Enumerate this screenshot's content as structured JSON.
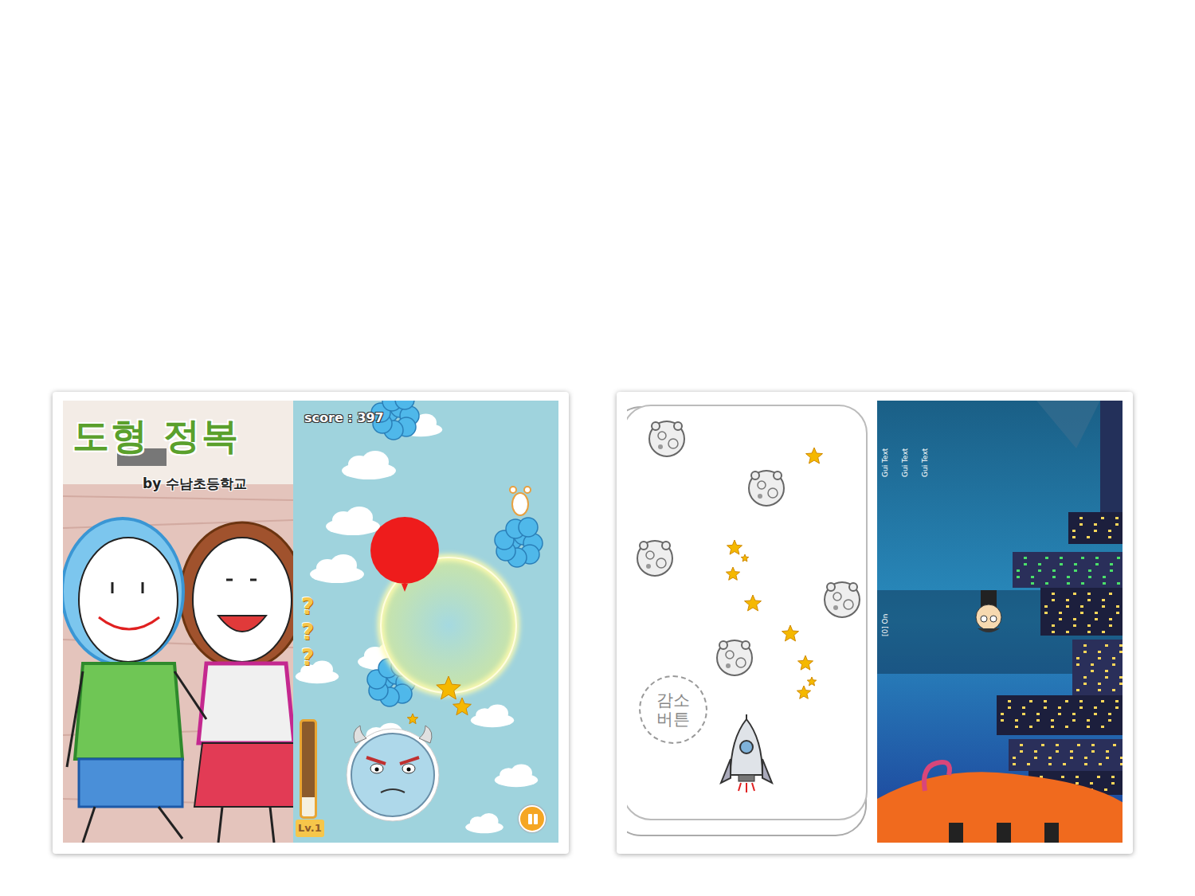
{
  "cards": [
    {
      "panels": [
        {
          "kind": "cover",
          "title": "도형 정복",
          "subtitle": "by 수남초등학교"
        },
        {
          "kind": "balloon",
          "score": "score : 397",
          "hints": [
            "?",
            "?",
            "?"
          ],
          "level_label": "Lv.1",
          "level": 0.2
        }
      ]
    },
    {
      "panels": [
        {
          "kind": "rocket",
          "button_lines": [
            "감소",
            "버튼"
          ]
        },
        {
          "kind": "night",
          "gui_texts": [
            "Gui Text",
            "Gui Text",
            "Gui Text"
          ],
          "toggle": "[0] On"
        }
      ]
    }
  ]
}
